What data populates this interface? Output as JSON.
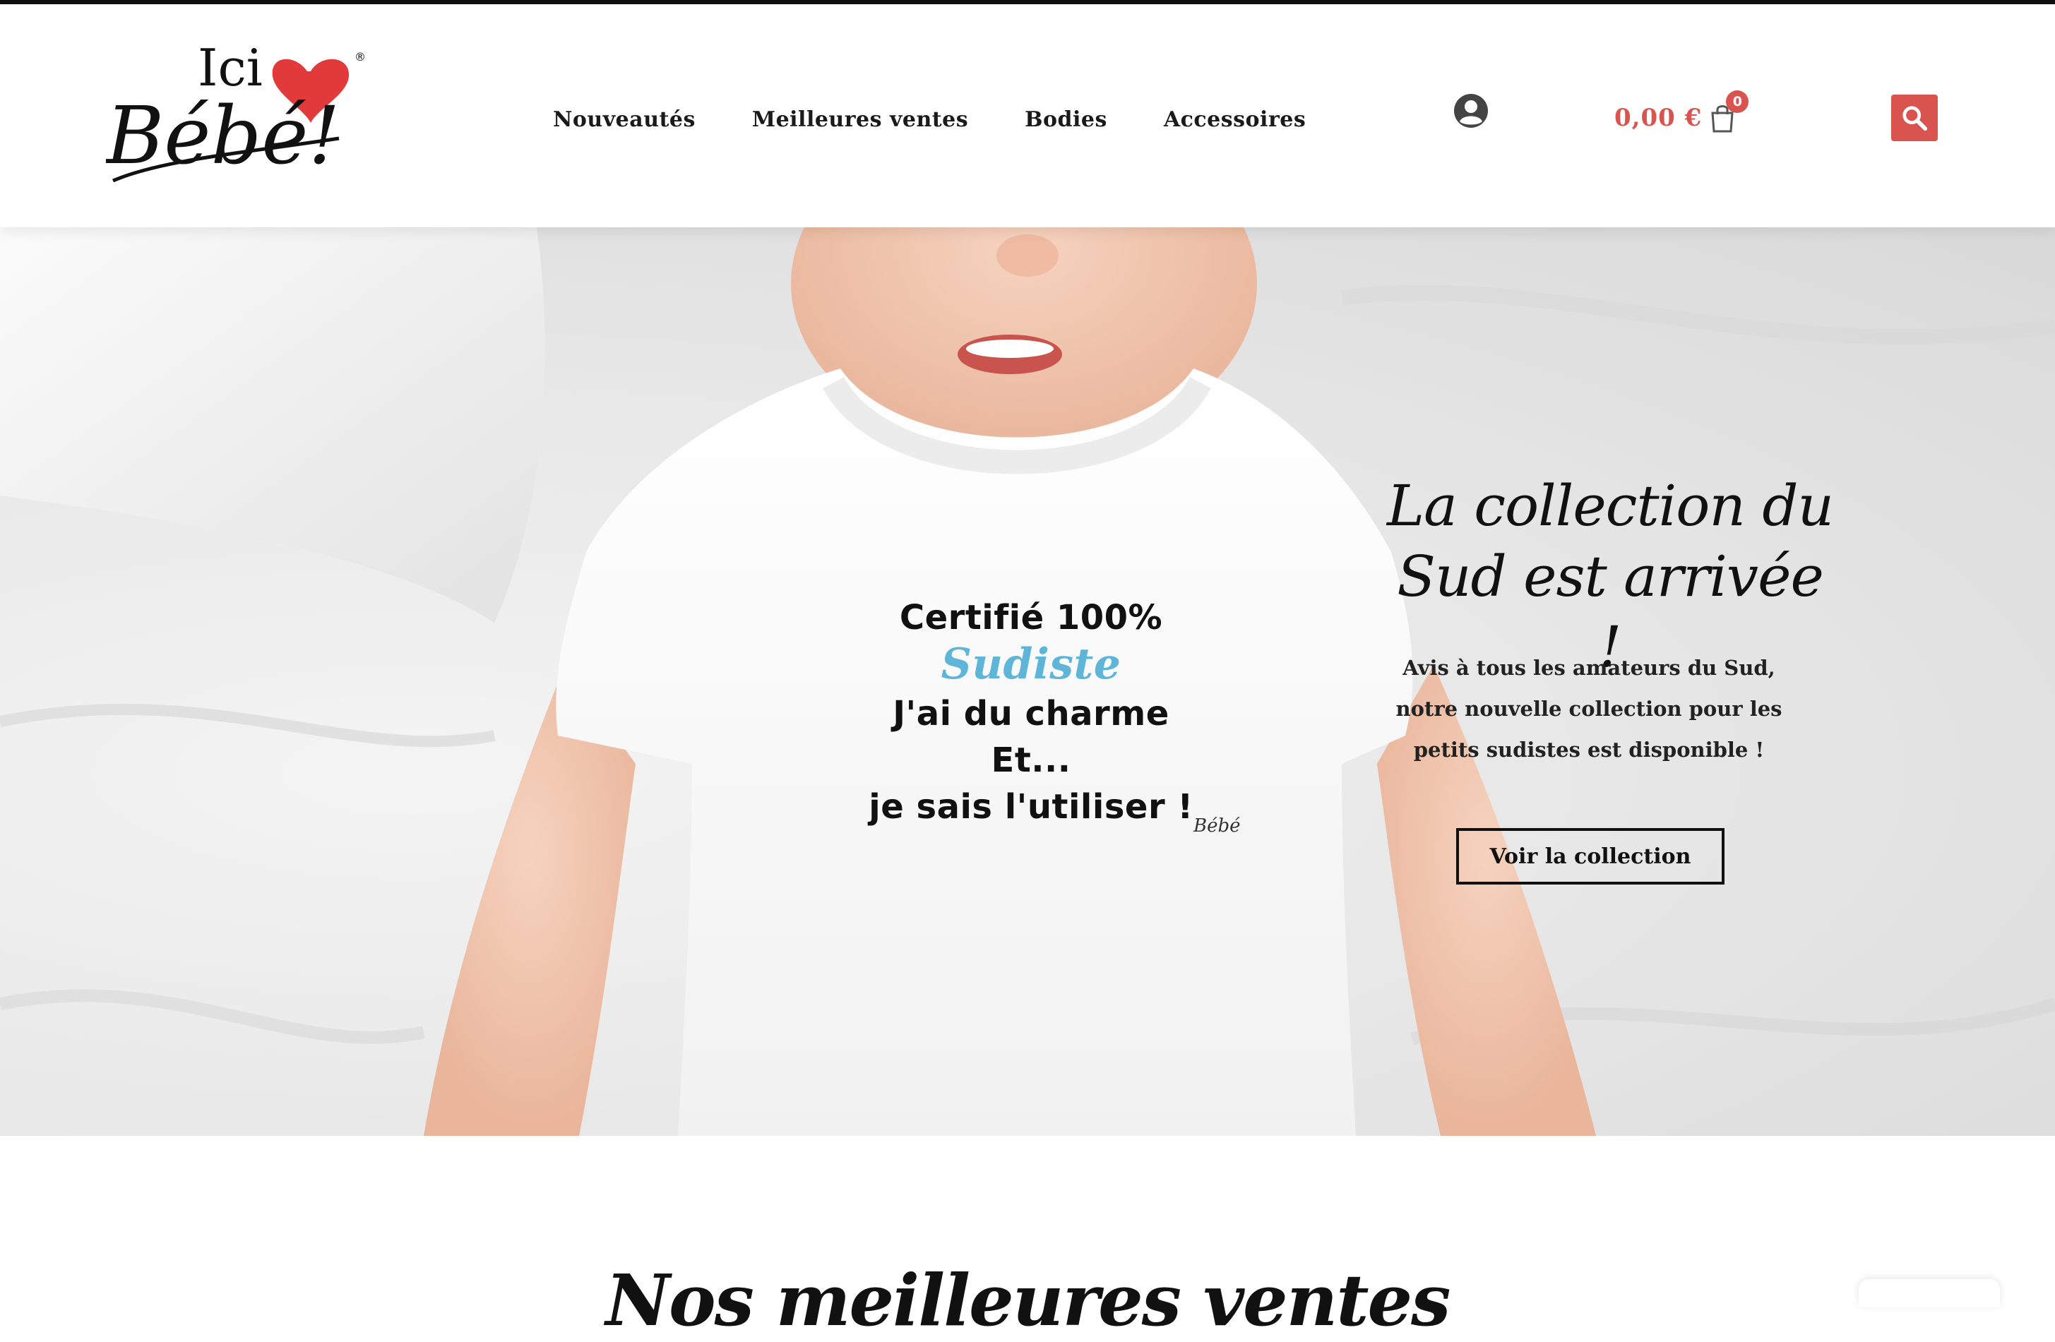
{
  "brand": {
    "logo_top": "Ici",
    "logo_bottom": "Bébé!",
    "registered": "®"
  },
  "nav": {
    "items": [
      "Nouveautés",
      "Meilleures ventes",
      "Bodies",
      "Accessoires"
    ]
  },
  "header": {
    "account_icon": "user-circle-icon",
    "cart_total": "0,00 €",
    "cart_count": "0",
    "cart_icon": "shopping-bag-icon",
    "search_icon": "search-icon",
    "accent_color": "#d9534f"
  },
  "hero": {
    "headline": "La collection du Sud est arrivée !",
    "body": "Avis à tous les amateurs du Sud, notre nouvelle collection pour les petits sudistes est disponible !",
    "cta": "Voir la collection",
    "shirt_print": {
      "line1_start": "Certifié 100%",
      "line1_accent": "Sudiste",
      "line2": "J'ai du charme",
      "line3": "Et...",
      "line4": "je sais l'utiliser !"
    }
  },
  "sections": {
    "bestsellers_title": "Nos meilleures ventes"
  }
}
